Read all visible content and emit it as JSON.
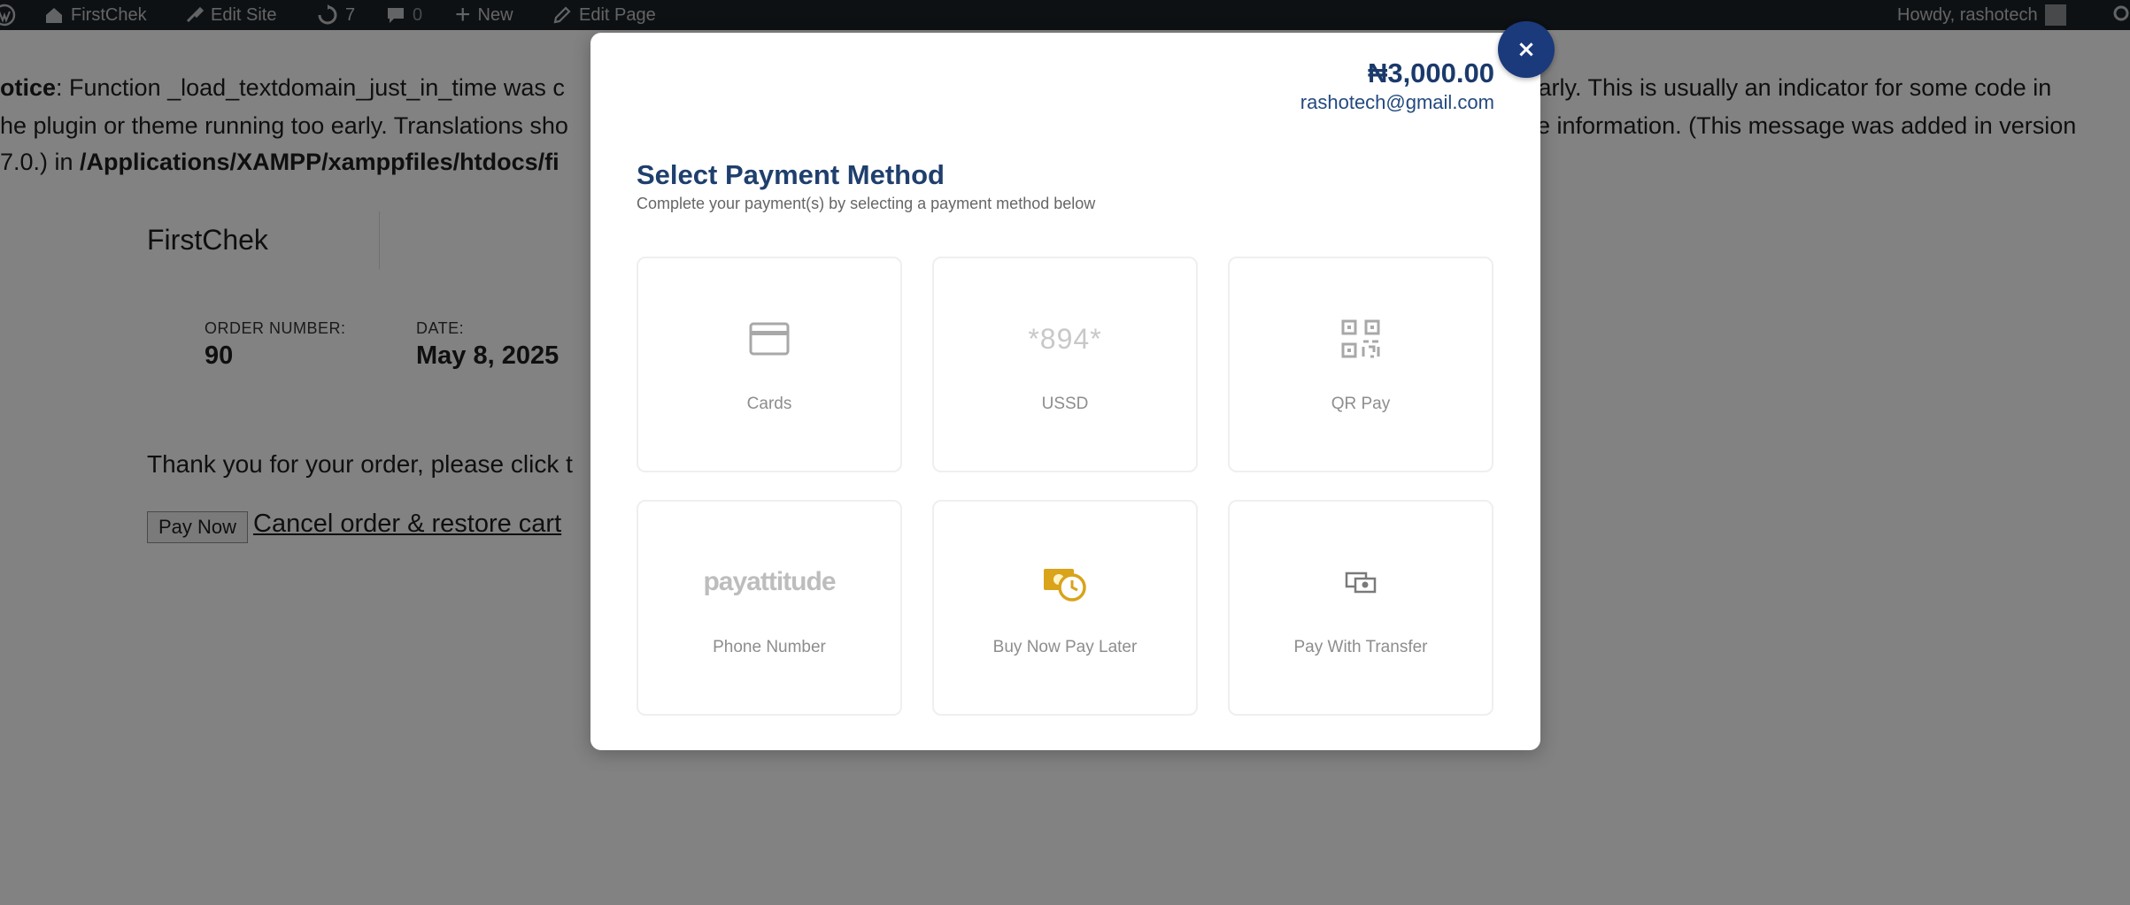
{
  "admin_bar": {
    "site_name": "FirstChek",
    "edit_site": "Edit Site",
    "updates_count": "7",
    "comments_count": "0",
    "new_label": "New",
    "edit_page": "Edit Page",
    "howdy": "Howdy, rashotech"
  },
  "notice": {
    "line1_prefix": "otice",
    "line1_left": ": Function _load_textdomain_just_in_time was c",
    "line1_right": "o early. This is usually an indicator for some code in",
    "line2_left": "he plugin or theme running too early. Translations sho",
    "line2_right": "ore information. (This message was added in version",
    "line3_prefix": "7.0.) in ",
    "line3_path": "/Applications/XAMPP/xamppfiles/htdocs/fi"
  },
  "order": {
    "site_name": "FirstChek",
    "order_number_label": "ORDER NUMBER:",
    "order_number": "90",
    "date_label": "DATE:",
    "date": "May 8, 2025",
    "thanks_text": "Thank you for your order, please click t",
    "pay_now": "Pay Now",
    "cancel_link": "Cancel order & restore cart"
  },
  "modal": {
    "amount": "₦3,000.00",
    "email": "rashotech@gmail.com",
    "title": "Select Payment Method",
    "subtitle": "Complete your payment(s) by selecting a payment method below",
    "close_symbol": "×",
    "methods": [
      {
        "label": "Cards",
        "icon": "card-icon"
      },
      {
        "label": "USSD",
        "icon": "ussd-icon",
        "icon_text": "*894*"
      },
      {
        "label": "QR Pay",
        "icon": "qr-code-icon"
      },
      {
        "label": "Phone Number",
        "icon": "payattitude-logo",
        "icon_text": "payattitude"
      },
      {
        "label": "Buy Now Pay Later",
        "icon": "money-clock-icon"
      },
      {
        "label": "Pay With Transfer",
        "icon": "transfer-icon"
      }
    ]
  },
  "colors": {
    "accent": "#1a3a7c",
    "title": "#1f3f6d",
    "overlay": "rgba(0,0,0,0.49)",
    "bnpl_gold": "#d9a31a"
  }
}
